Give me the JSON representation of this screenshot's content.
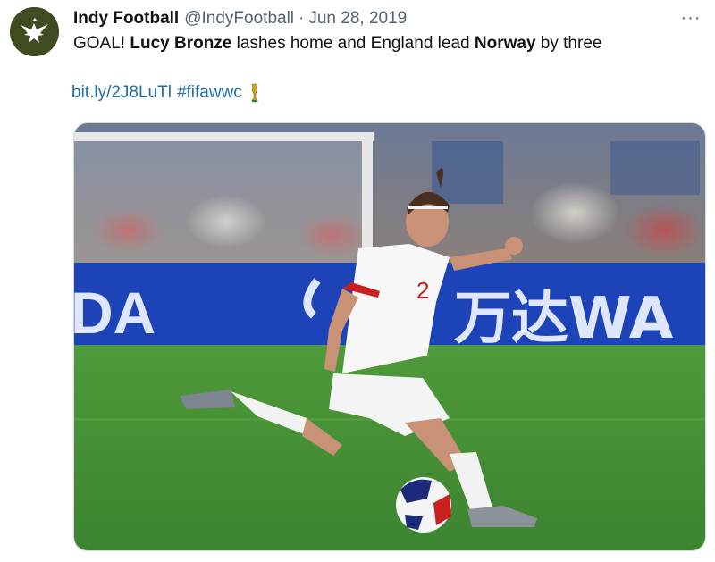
{
  "tweet": {
    "display_name": "Indy Football",
    "handle": "@IndyFootball",
    "separator": "·",
    "date": "Jun 28, 2019",
    "more_label": "···",
    "text_parts": {
      "p1": "GOAL! ",
      "b1": "Lucy Bronze",
      "p2": " lashes home and England lead ",
      "b2": "Norway",
      "p3": " by three"
    },
    "link": "bit.ly/2J8LuTl",
    "hashtag": "#fifawwc",
    "trophy_icon": "trophy-icon"
  },
  "media": {
    "board_text_left": "DA",
    "board_text_right": "万达WA",
    "shirt_number": "2"
  },
  "colors": {
    "link": "#1d6fa5",
    "avatar_bg": "#3e4a1f",
    "pitch": "#3f8a2e",
    "board": "#1c43b8"
  }
}
